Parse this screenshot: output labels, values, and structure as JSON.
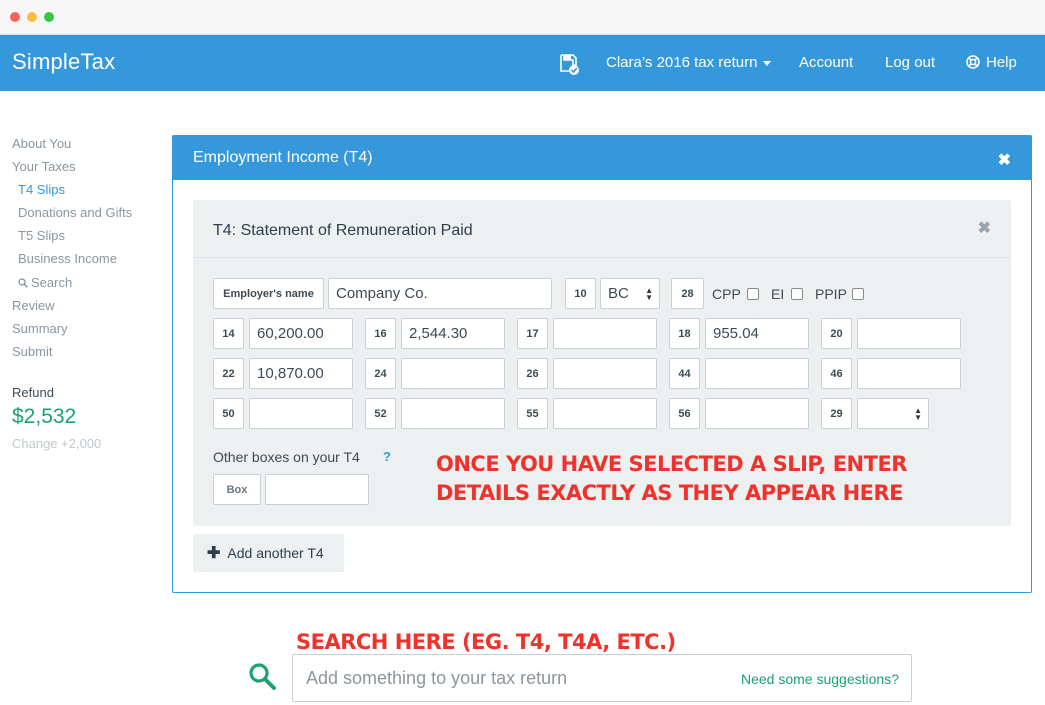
{
  "topbar": {
    "brand": "SimpleTax",
    "return_menu": "Clara’s 2016 tax return",
    "account": "Account",
    "logout": "Log out",
    "help": "Help"
  },
  "sidebar": {
    "items": [
      {
        "label": "About You"
      },
      {
        "label": "Your Taxes"
      },
      {
        "label": "T4 Slips"
      },
      {
        "label": "Donations and Gifts"
      },
      {
        "label": "T5 Slips"
      },
      {
        "label": "Business Income"
      },
      {
        "label": "Search"
      },
      {
        "label": "Review"
      },
      {
        "label": "Summary"
      },
      {
        "label": "Submit"
      }
    ],
    "refund_label": "Refund",
    "refund_amount": "$2,532",
    "refund_change": "Change +2,000"
  },
  "panel": {
    "title": "Employment Income (T4)",
    "close": "✖"
  },
  "slip": {
    "title": "T4: Statement of Remuneration Paid",
    "close": "✖",
    "employer_label": "Employer's name",
    "employer_value": "Company Co.",
    "box10": "10",
    "province": "BC",
    "box28": "28",
    "cpp": "CPP",
    "ei": "EI",
    "ppip": "PPIP",
    "rows": [
      [
        {
          "box": "14",
          "value": "60,200.00"
        },
        {
          "box": "16",
          "value": "2,544.30"
        },
        {
          "box": "17",
          "value": ""
        },
        {
          "box": "18",
          "value": "955.04"
        },
        {
          "box": "20",
          "value": ""
        }
      ],
      [
        {
          "box": "22",
          "value": "10,870.00"
        },
        {
          "box": "24",
          "value": ""
        },
        {
          "box": "26",
          "value": ""
        },
        {
          "box": "44",
          "value": ""
        },
        {
          "box": "46",
          "value": ""
        }
      ],
      [
        {
          "box": "50",
          "value": ""
        },
        {
          "box": "52",
          "value": ""
        },
        {
          "box": "55",
          "value": ""
        },
        {
          "box": "56",
          "value": ""
        },
        {
          "box": "29",
          "value": ""
        }
      ]
    ],
    "other_label": "Other boxes on your T4",
    "help_q": "?",
    "box_label": "Box",
    "box_value": ""
  },
  "annotations": {
    "slip_line1": "ONCE YOU HAVE SELECTED A SLIP, ENTER",
    "slip_line2": "DETAILS EXACTLY AS THEY APPEAR HERE",
    "search": "SEARCH HERE (EG. T4, T4A, ETC.)"
  },
  "add_button": "Add another T4",
  "search": {
    "placeholder": "Add something to your tax return",
    "suggestions": "Need some suggestions?"
  },
  "colors": {
    "brand_blue": "#3498db",
    "refund_green": "#1aa36f",
    "annotation_red": "#f0322c"
  },
  "icons": {
    "save": "save-check-icon",
    "help": "lifebuoy-icon",
    "search": "search-icon",
    "plus": "plus-icon",
    "close": "close-icon"
  }
}
